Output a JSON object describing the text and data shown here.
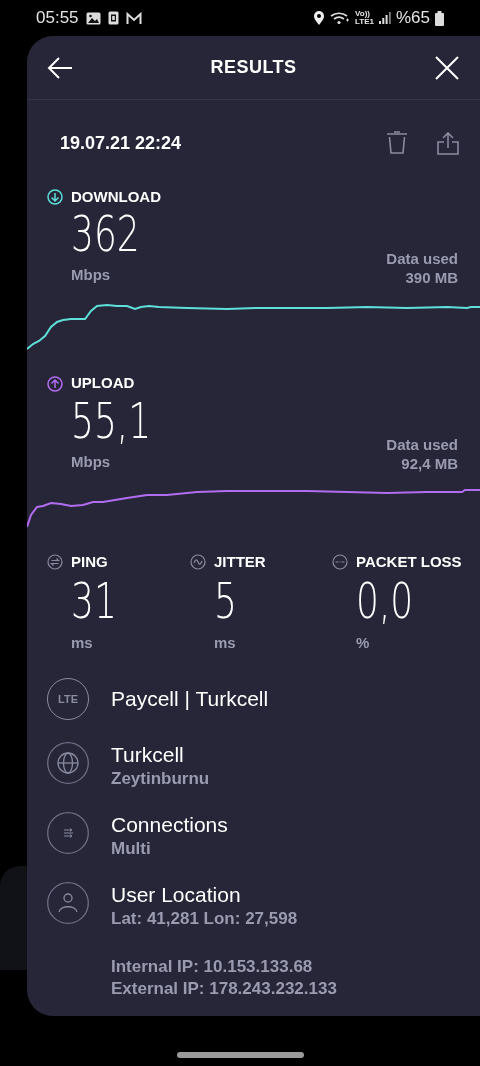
{
  "status_bar": {
    "time": "05:55",
    "network_top": "Vo))",
    "network_bottom": "LTE1",
    "battery": "%65"
  },
  "header": {
    "title": "RESULTS"
  },
  "date": "19.07.21 22:24",
  "speeds": [
    {
      "kind": "download",
      "label": "DOWNLOAD",
      "value": "362",
      "unit": "Mbps",
      "data_label": "Data used",
      "data_value": "390 MB",
      "color": "#5ee0d9"
    },
    {
      "kind": "upload",
      "label": "UPLOAD",
      "value": "55,1",
      "unit": "Mbps",
      "data_label": "Data used",
      "data_value": "92,4 MB",
      "color": "#b26cf0"
    }
  ],
  "stats": [
    {
      "kind": "ping",
      "label": "PING",
      "value": "31",
      "unit": "ms"
    },
    {
      "kind": "jitter",
      "label": "JITTER",
      "value": "5",
      "unit": "ms"
    },
    {
      "kind": "packet_loss",
      "label": "PACKET LOSS",
      "value": "0,0",
      "unit": "%"
    }
  ],
  "info": [
    {
      "kind": "lte",
      "icon_text": "LTE",
      "title": "Paycell | Turkcell"
    },
    {
      "kind": "globe",
      "title": "Turkcell",
      "subtitle": "Zeytinburnu"
    },
    {
      "kind": "connections",
      "title": "Connections",
      "subtitle": "Multi"
    },
    {
      "kind": "person",
      "title": "User Location",
      "subtitle": "Lat: 41,281 Lon: 27,598"
    }
  ],
  "ip_lines": [
    "Internal IP: 10.153.133.68",
    "External IP: 178.243.232.133"
  ]
}
